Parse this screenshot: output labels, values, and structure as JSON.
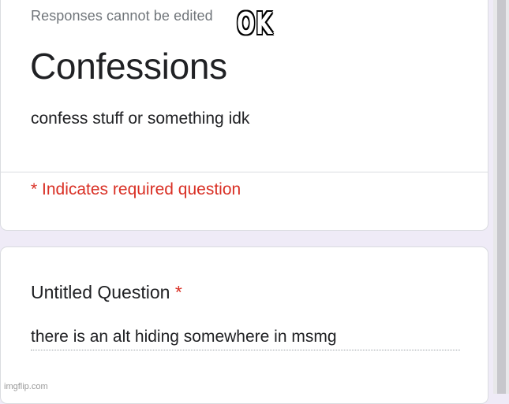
{
  "form": {
    "notice": "Responses cannot be edited",
    "title": "Confessions",
    "description": "confess stuff or something idk",
    "required_note": "* Indicates required question"
  },
  "question": {
    "title": "Untitled Question",
    "required_marker": "*",
    "answer": "there is an alt hiding somewhere in msmg"
  },
  "overlay": {
    "caption": "OK",
    "watermark": "imgflip.com"
  },
  "colors": {
    "background": "#efebf7",
    "required_red": "#d93025",
    "text": "#202124",
    "muted": "#70757a"
  }
}
